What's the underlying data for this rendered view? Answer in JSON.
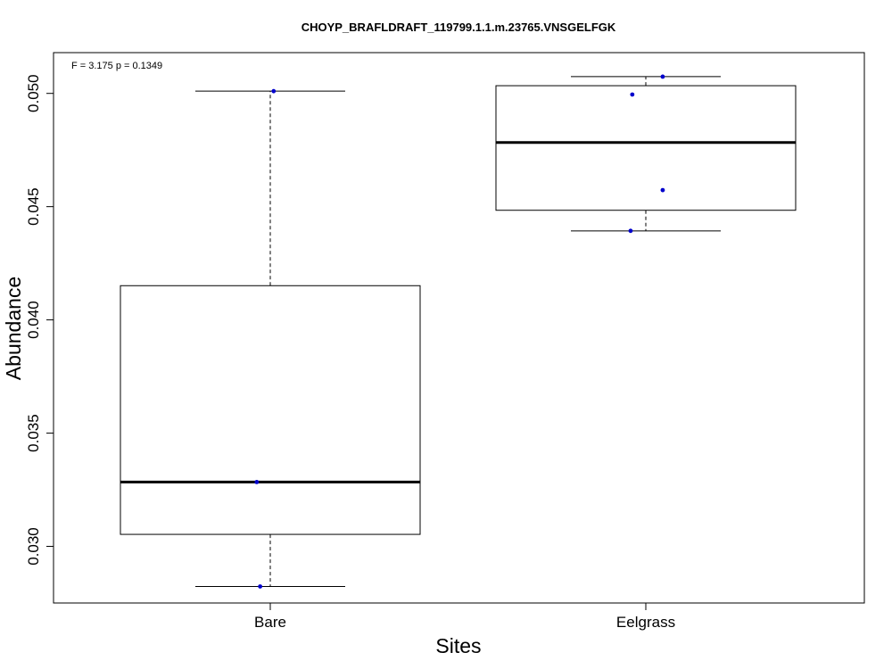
{
  "chart_data": {
    "type": "boxplot",
    "title": "CHOYP_BRAFLDRAFT_119799.1.1.m.23765.VNSGELFGK",
    "xlabel": "Sites",
    "ylabel": "Abundance",
    "annotation": "F = 3.175 p = 0.1349",
    "ylim": [
      0.0275,
      0.0518
    ],
    "yticks": [
      0.03,
      0.035,
      0.04,
      0.045,
      0.05
    ],
    "ytick_labels": [
      "0.030",
      "0.035",
      "0.040",
      "0.045",
      "0.050"
    ],
    "categories": [
      "Bare",
      "Eelgrass"
    ],
    "boxes": [
      {
        "category": "Bare",
        "whisker_low": 0.02823,
        "q1": 0.03053,
        "median": 0.03284,
        "q3": 0.04151,
        "whisker_high": 0.0501
      },
      {
        "category": "Eelgrass",
        "whisker_low": 0.04393,
        "q1": 0.04484,
        "median": 0.04783,
        "q3": 0.05034,
        "whisker_high": 0.05074
      }
    ],
    "points": [
      {
        "category": "Bare",
        "value": 0.0501,
        "jitter": 0.02
      },
      {
        "category": "Bare",
        "value": 0.03284,
        "jitter": -0.08
      },
      {
        "category": "Bare",
        "value": 0.02823,
        "jitter": -0.06
      },
      {
        "category": "Eelgrass",
        "value": 0.05074,
        "jitter": 0.1
      },
      {
        "category": "Eelgrass",
        "value": 0.04995,
        "jitter": -0.08
      },
      {
        "category": "Eelgrass",
        "value": 0.04573,
        "jitter": 0.1
      },
      {
        "category": "Eelgrass",
        "value": 0.04393,
        "jitter": -0.09
      }
    ],
    "point_color": "#0000cc",
    "grid": false,
    "legend": "none"
  }
}
